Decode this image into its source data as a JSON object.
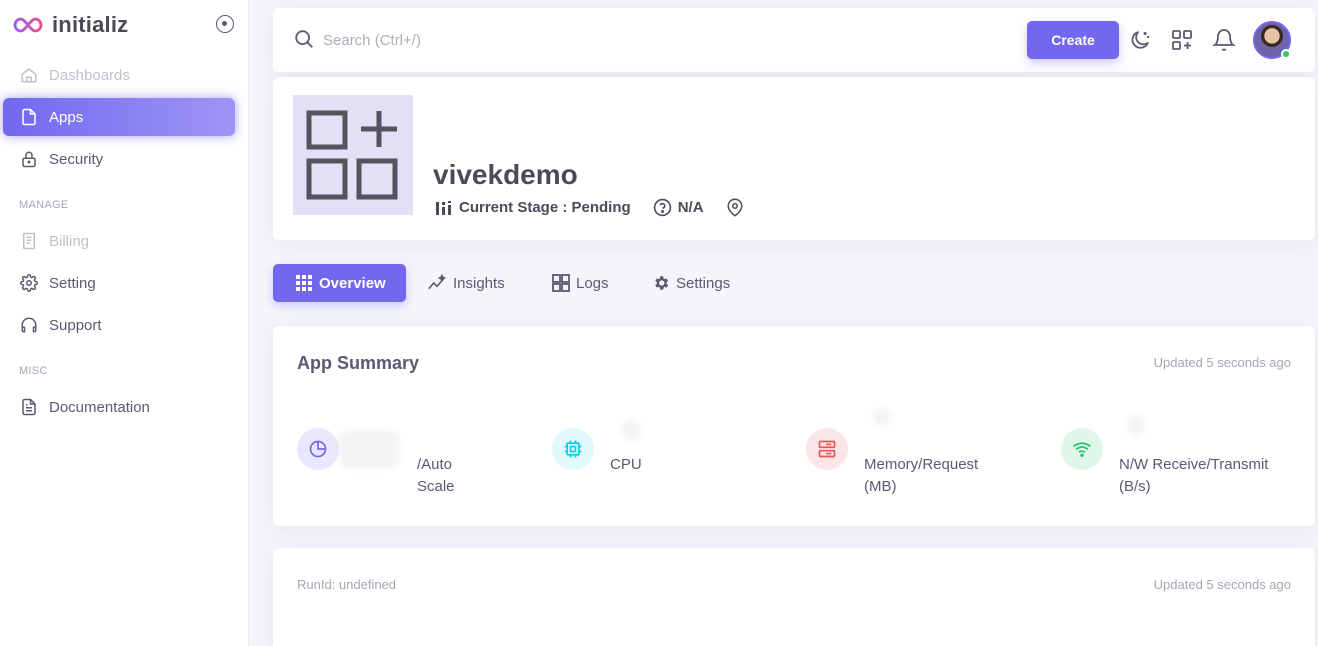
{
  "brand": {
    "name": "initializ"
  },
  "sidebar": {
    "items": [
      {
        "label": "Dashboards",
        "icon": "home-icon",
        "state": "disabled"
      },
      {
        "label": "Apps",
        "icon": "file-icon",
        "state": "active"
      },
      {
        "label": "Security",
        "icon": "lock-icon",
        "state": "normal"
      }
    ],
    "sections": [
      {
        "label": "MANAGE",
        "items": [
          {
            "label": "Billing",
            "icon": "receipt-icon",
            "state": "disabled"
          },
          {
            "label": "Setting",
            "icon": "gear-icon",
            "state": "normal"
          },
          {
            "label": "Support",
            "icon": "headphones-icon",
            "state": "normal"
          }
        ]
      },
      {
        "label": "MISC",
        "items": [
          {
            "label": "Documentation",
            "icon": "document-icon",
            "state": "normal"
          }
        ]
      }
    ]
  },
  "header": {
    "search_placeholder": "Search (Ctrl+/)",
    "create_label": "Create",
    "icons": [
      "moon-icon",
      "apps-add-icon",
      "bell-icon"
    ],
    "status_color": "#28c76f"
  },
  "app": {
    "name": "vivekdemo",
    "stage": "Current Stage : Pending",
    "status": "N/A"
  },
  "tabs": [
    {
      "label": "Overview",
      "icon": "grid-icon",
      "active": true
    },
    {
      "label": "Insights",
      "icon": "trend-icon",
      "active": false
    },
    {
      "label": "Logs",
      "icon": "logs-grid-icon",
      "active": false
    },
    {
      "label": "Settings",
      "icon": "cog-icon",
      "active": false
    }
  ],
  "summary": {
    "title": "App Summary",
    "updated": "Updated 5 seconds ago",
    "stats": [
      {
        "label": "/Auto Scale",
        "icon": "pie-chart-icon",
        "color": "#7367f0"
      },
      {
        "label": "CPU",
        "icon": "cpu-icon",
        "color": "#00cfe8"
      },
      {
        "label": "Memory/Request (MB)",
        "icon": "server-icon",
        "color": "#ea5455"
      },
      {
        "label": "N/W Receive/Transmit (B/s)",
        "icon": "wifi-icon",
        "color": "#28c76f"
      }
    ]
  },
  "run": {
    "label": "RunId: undefined",
    "updated": "Updated 5 seconds ago"
  },
  "colors": {
    "primary": "#7367f0",
    "page_bg": "#f4f5fa"
  }
}
